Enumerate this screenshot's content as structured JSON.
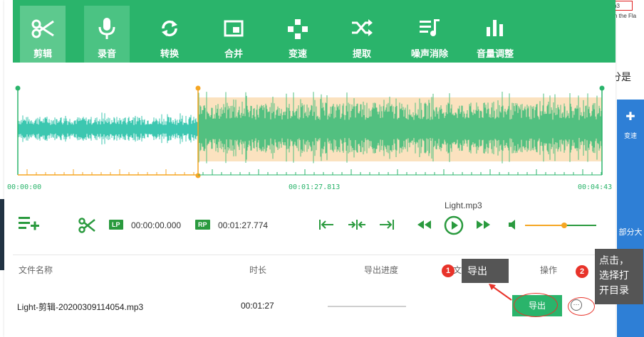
{
  "background": {
    "red_box_text": "p3",
    "flash_text": "ith the Fla",
    "side_text": "分是",
    "right_panel_item": "变速",
    "right_panel_text": "部分大"
  },
  "toolbar": {
    "items": [
      {
        "label": "剪辑",
        "icon": "scissors-icon"
      },
      {
        "label": "录音",
        "icon": "microphone-icon"
      },
      {
        "label": "转换",
        "icon": "convert-icon"
      },
      {
        "label": "合并",
        "icon": "merge-icon"
      },
      {
        "label": "变速",
        "icon": "speed-icon"
      },
      {
        "label": "提取",
        "icon": "extract-icon"
      },
      {
        "label": "噪声消除",
        "icon": "noise-icon"
      },
      {
        "label": "音量调整",
        "icon": "volume-bars-icon"
      }
    ]
  },
  "timeline": {
    "start": "00:00:00",
    "mid": "00:01:27.813",
    "end": "00:04:43"
  },
  "controls": {
    "lp_label": "LP",
    "lp_time": "00:00:00.000",
    "rp_label": "RP",
    "rp_time": "00:01:27.774",
    "file_name": "Light.mp3",
    "volume": 0.55
  },
  "table": {
    "headers": {
      "name": "文件名称",
      "duration": "时长",
      "progress": "导出进度",
      "folder": "文",
      "action": "操作"
    },
    "row": {
      "name": "Light-剪辑-20200309114054.mp3",
      "duration": "00:01:27",
      "export_label": "导出",
      "more_label": "···"
    }
  },
  "annotations": {
    "step1_num": "1",
    "step1_text": "导出",
    "step2_num": "2",
    "step2_lines": [
      "点击，",
      "选择打",
      "开目录"
    ]
  },
  "colors": {
    "brand_green": "#2ab46b",
    "selection": "#fbe2bf",
    "wave_teal": "#3cc7b0",
    "wave_green": "#52c080",
    "marker_orange": "#f5a623",
    "annotation_red": "#e8332a"
  }
}
